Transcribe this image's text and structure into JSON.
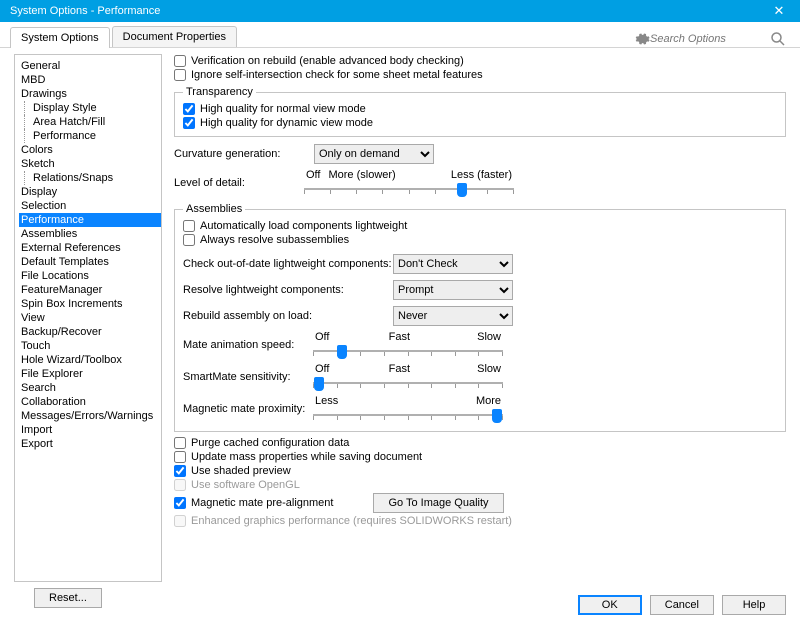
{
  "window": {
    "title": "System Options - Performance"
  },
  "tabs": [
    {
      "label": "System Options",
      "active": true
    },
    {
      "label": "Document Properties",
      "active": false
    }
  ],
  "search": {
    "placeholder": "Search Options"
  },
  "tree": [
    {
      "label": "General",
      "lvl": 1
    },
    {
      "label": "MBD",
      "lvl": 1
    },
    {
      "label": "Drawings",
      "lvl": 1
    },
    {
      "label": "Display Style",
      "lvl": 2
    },
    {
      "label": "Area Hatch/Fill",
      "lvl": 2
    },
    {
      "label": "Performance",
      "lvl": 2
    },
    {
      "label": "Colors",
      "lvl": 1
    },
    {
      "label": "Sketch",
      "lvl": 1
    },
    {
      "label": "Relations/Snaps",
      "lvl": 2
    },
    {
      "label": "Display",
      "lvl": 1
    },
    {
      "label": "Selection",
      "lvl": 1
    },
    {
      "label": "Performance",
      "lvl": 1,
      "selected": true
    },
    {
      "label": "Assemblies",
      "lvl": 1
    },
    {
      "label": "External References",
      "lvl": 1
    },
    {
      "label": "Default Templates",
      "lvl": 1
    },
    {
      "label": "File Locations",
      "lvl": 1
    },
    {
      "label": "FeatureManager",
      "lvl": 1
    },
    {
      "label": "Spin Box Increments",
      "lvl": 1
    },
    {
      "label": "View",
      "lvl": 1
    },
    {
      "label": "Backup/Recover",
      "lvl": 1
    },
    {
      "label": "Touch",
      "lvl": 1
    },
    {
      "label": "Hole Wizard/Toolbox",
      "lvl": 1
    },
    {
      "label": "File Explorer",
      "lvl": 1
    },
    {
      "label": "Search",
      "lvl": 1
    },
    {
      "label": "Collaboration",
      "lvl": 1
    },
    {
      "label": "Messages/Errors/Warnings",
      "lvl": 1
    },
    {
      "label": "Import",
      "lvl": 1
    },
    {
      "label": "Export",
      "lvl": 1
    }
  ],
  "top_checks": [
    {
      "label": "Verification on rebuild (enable advanced body checking)",
      "checked": false
    },
    {
      "label": "Ignore self-intersection check for some sheet metal features",
      "checked": false
    }
  ],
  "transparency": {
    "legend": "Transparency",
    "items": [
      {
        "label": "High quality for normal view mode",
        "checked": true
      },
      {
        "label": "High quality for dynamic view mode",
        "checked": true
      }
    ]
  },
  "curvature": {
    "label": "Curvature generation:",
    "value": "Only on demand"
  },
  "level_of_detail": {
    "label": "Level of detail:",
    "off": "Off",
    "more": "More (slower)",
    "less": "Less (faster)",
    "pos_pct": 75
  },
  "assemblies": {
    "legend": "Assemblies",
    "checks": [
      {
        "label": "Automatically load components lightweight",
        "checked": false
      },
      {
        "label": "Always resolve subassemblies",
        "checked": false
      }
    ],
    "check_ood": {
      "label": "Check out-of-date lightweight components:",
      "value": "Don't Check"
    },
    "resolve_lw": {
      "label": "Resolve lightweight components:",
      "value": "Prompt"
    },
    "rebuild": {
      "label": "Rebuild assembly on load:",
      "value": "Never"
    },
    "mate_anim": {
      "label": "Mate animation speed:",
      "off": "Off",
      "fast": "Fast",
      "slow": "Slow",
      "pos_pct": 15
    },
    "smartmate": {
      "label": "SmartMate sensitivity:",
      "off": "Off",
      "fast": "Fast",
      "slow": "Slow",
      "pos_pct": 3
    },
    "mag_prox": {
      "label": "Magnetic mate proximity:",
      "less": "Less",
      "more": "More",
      "pos_pct": 97
    }
  },
  "bottom_checks": [
    {
      "label": "Purge cached configuration data",
      "checked": false,
      "disabled": false
    },
    {
      "label": "Update mass properties while saving document",
      "checked": false,
      "disabled": false
    },
    {
      "label": "Use shaded preview",
      "checked": true,
      "disabled": false
    },
    {
      "label": "Use software OpenGL",
      "checked": false,
      "disabled": true
    },
    {
      "label": "Magnetic mate pre-alignment",
      "checked": true,
      "disabled": false
    },
    {
      "label": "Enhanced graphics performance (requires SOLIDWORKS restart)",
      "checked": false,
      "disabled": true
    }
  ],
  "buttons": {
    "image_quality": "Go To Image Quality",
    "reset": "Reset...",
    "ok": "OK",
    "cancel": "Cancel",
    "help": "Help"
  }
}
